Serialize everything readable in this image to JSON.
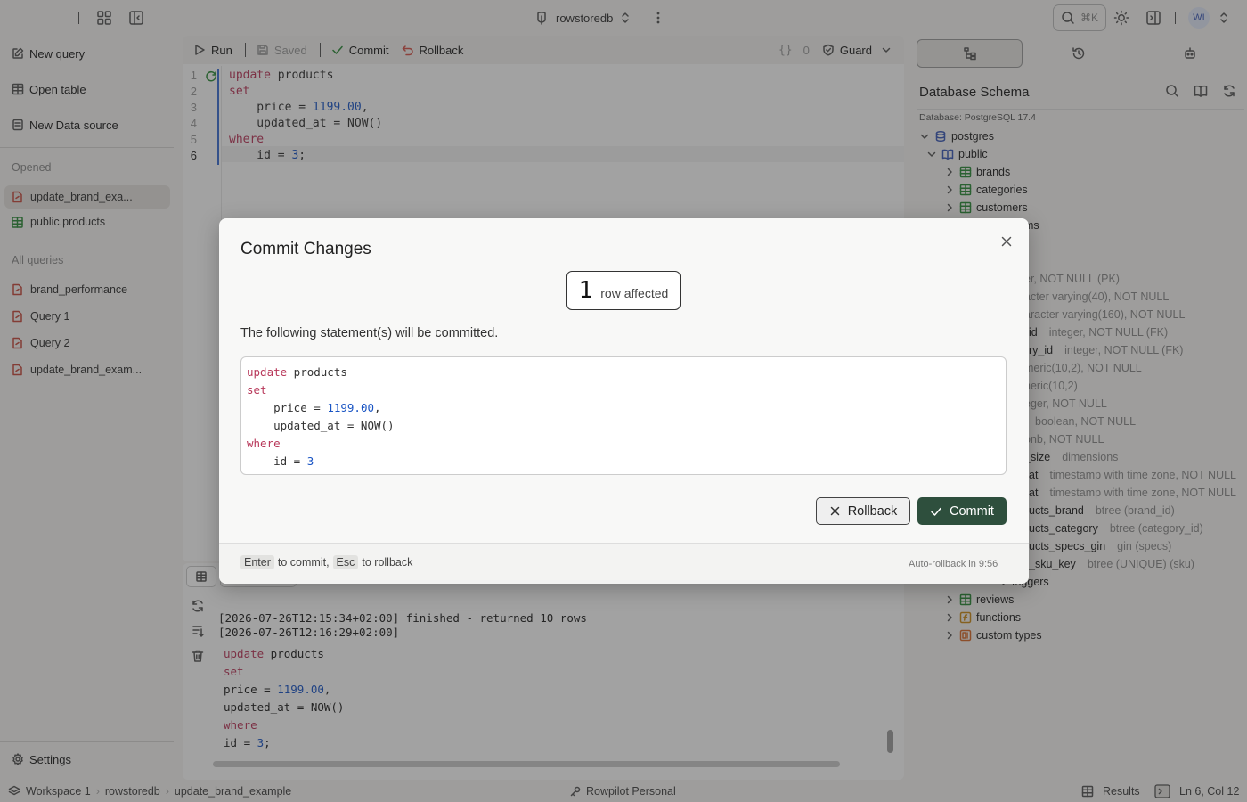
{
  "topbar": {
    "db_name": "rowstoredb",
    "search_shortcut": "⌘K",
    "avatar_initials": "WI"
  },
  "sidebar": {
    "actions": [
      "New query",
      "Open table",
      "New Data source"
    ],
    "opened_heading": "Opened",
    "opened": [
      "update_brand_exa...",
      "public.products"
    ],
    "all_heading": "All queries",
    "queries": [
      "brand_performance",
      "Query 1",
      "Query 2",
      "update_brand_exam..."
    ],
    "settings": "Settings"
  },
  "editor": {
    "run": "Run",
    "saved": "Saved",
    "commit": "Commit",
    "rollback": "Rollback",
    "braces_count": "0",
    "guard": "Guard",
    "line_numbers": [
      "1",
      "2",
      "3",
      "4",
      "5",
      "6"
    ],
    "code": [
      {
        "kw": "update",
        "rest": " products"
      },
      {
        "kw": "set",
        "rest": ""
      },
      {
        "pre": "    price = ",
        "num": "1199.00",
        "post": ","
      },
      {
        "pre": "    updated_at = NOW()"
      },
      {
        "kw": "where",
        "rest": ""
      },
      {
        "pre": "    id = ",
        "num": "3",
        "post": ";"
      }
    ]
  },
  "log": {
    "lines": [
      "[2026-07-26T12:15:34+02:00] finished - returned 10 rows",
      "[2026-07-26T12:16:29+02:00]"
    ],
    "code": [
      {
        "kw": "update",
        "rest": " products"
      },
      {
        "kw": "set",
        "rest": ""
      },
      {
        "pre": "price = ",
        "num": "1199.00",
        "post": ","
      },
      {
        "pre": "updated_at = NOW()"
      },
      {
        "kw": "where",
        "rest": ""
      },
      {
        "pre": "id = ",
        "num": "3",
        "post": ";"
      }
    ]
  },
  "schema": {
    "title": "Database Schema",
    "subtitle": "Database: PostgreSQL 17.4",
    "root": "postgres",
    "schema_name": "public",
    "tables": [
      "brands",
      "categories",
      "customers"
    ],
    "partial_rows": [
      {
        "name": "ms",
        "meta": ""
      },
      {
        "name": "",
        "meta": "er, NOT NULL (PK)"
      },
      {
        "name": "",
        "meta": "acter varying(40), NOT NULL"
      },
      {
        "name": "",
        "meta": "aracter varying(160), NOT NULL"
      },
      {
        "name": "id",
        "meta": "integer, NOT NULL (FK)"
      },
      {
        "name": "ry_id",
        "meta": "integer, NOT NULL (FK)"
      },
      {
        "name": "",
        "meta": "meric(10,2), NOT NULL"
      },
      {
        "name": "",
        "meta": "neric(10,2)"
      },
      {
        "name": "",
        "meta": "eger, NOT NULL"
      },
      {
        "name": "",
        "meta": "boolean, NOT NULL"
      },
      {
        "name": "",
        "meta": "onb, NOT NULL"
      },
      {
        "name": "_size",
        "meta": "dimensions"
      },
      {
        "name": "at",
        "meta": "timestamp with time zone, NOT NULL"
      },
      {
        "name": "at",
        "meta": "timestamp with time zone, NOT NULL"
      },
      {
        "name": "ucts_brand",
        "meta": "btree (brand_id)"
      },
      {
        "name": "ucts_category",
        "meta": "btree (category_id)"
      },
      {
        "name": "ucts_specs_gin",
        "meta": "gin (specs)"
      },
      {
        "name": "_sku_key",
        "meta": "btree (UNIQUE) (sku)"
      },
      {
        "name": "triggers",
        "meta": ""
      }
    ],
    "bottom_items": [
      "reviews",
      "functions",
      "custom types"
    ]
  },
  "statusbar": {
    "workspace": "Workspace 1",
    "db": "rowstoredb",
    "query": "update_brand_example",
    "plan": "Rowpilot Personal",
    "results": "Results",
    "position": "Ln 6, Col 12"
  },
  "modal": {
    "title": "Commit Changes",
    "rows_count": "1",
    "rows_label": "row affected",
    "description": "The following statement(s) will be committed.",
    "code": [
      {
        "kw": "update",
        "rest": " products"
      },
      {
        "kw": "set",
        "rest": ""
      },
      {
        "pre": "    price = ",
        "num": "1199.00",
        "post": ","
      },
      {
        "pre": "    updated_at = NOW()"
      },
      {
        "kw": "where",
        "rest": ""
      },
      {
        "pre": "    id = ",
        "num": "3",
        "post": ""
      }
    ],
    "rollback": "Rollback",
    "commit": "Commit",
    "enter_key": "Enter",
    "enter_hint": "to commit,",
    "esc_key": "Esc",
    "esc_hint": "to rollback",
    "auto_rollback": "Auto-rollback in 9:56"
  },
  "colors": {
    "keyword": "#b8385a",
    "number": "#1a55c4",
    "commit_bg": "#2e4f3d",
    "accent_green": "#2e8b3a"
  }
}
